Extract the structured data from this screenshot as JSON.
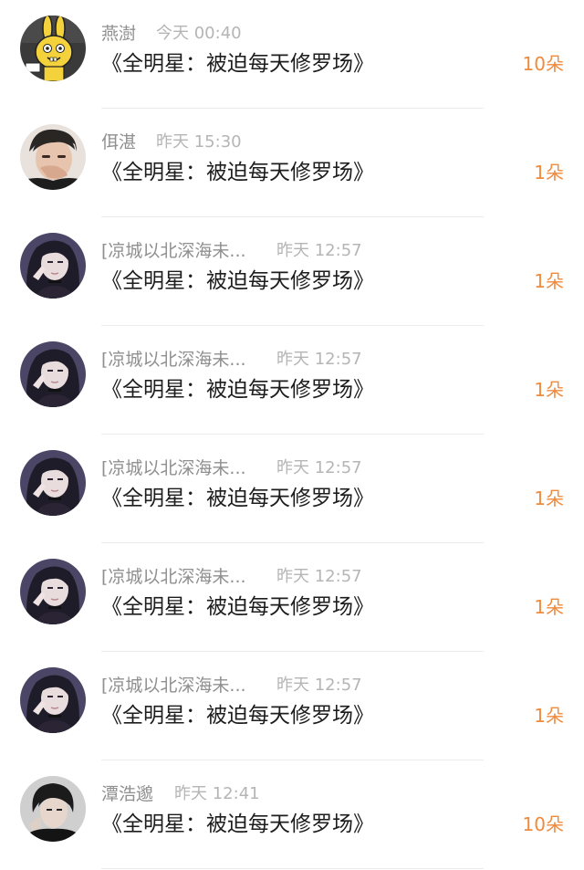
{
  "items": [
    {
      "name": "燕澍",
      "time": "今天 00:40",
      "title": "《全明星：被迫每天修罗场》",
      "count": "10朵",
      "avatar": "cartoon-bunny-avatar"
    },
    {
      "name": "佴湛",
      "time": "昨天 15:30",
      "title": "《全明星：被迫每天修罗场》",
      "count": "1朵",
      "avatar": "young-man-avatar"
    },
    {
      "name": "[凉城以北深海未...",
      "time": "昨天 12:57",
      "title": "《全明星：被迫每天修罗场》",
      "count": "1朵",
      "avatar": "girl-dark-hair-avatar"
    },
    {
      "name": "[凉城以北深海未...",
      "time": "昨天 12:57",
      "title": "《全明星：被迫每天修罗场》",
      "count": "1朵",
      "avatar": "girl-dark-hair-avatar"
    },
    {
      "name": "[凉城以北深海未...",
      "time": "昨天 12:57",
      "title": "《全明星：被迫每天修罗场》",
      "count": "1朵",
      "avatar": "girl-dark-hair-avatar"
    },
    {
      "name": "[凉城以北深海未...",
      "time": "昨天 12:57",
      "title": "《全明星：被迫每天修罗场》",
      "count": "1朵",
      "avatar": "girl-dark-hair-avatar"
    },
    {
      "name": "[凉城以北深海未...",
      "time": "昨天 12:57",
      "title": "《全明星：被迫每天修罗场》",
      "count": "1朵",
      "avatar": "girl-dark-hair-avatar"
    },
    {
      "name": "潭浩邈",
      "time": "昨天 12:41",
      "title": "《全明星：被迫每天修罗场》",
      "count": "10朵",
      "avatar": "man-dark-portrait-avatar"
    }
  ],
  "colors": {
    "accent": "#f08a3c",
    "name": "#8f8f8f",
    "time": "#b5b5b5",
    "title": "#1d1d1d"
  }
}
